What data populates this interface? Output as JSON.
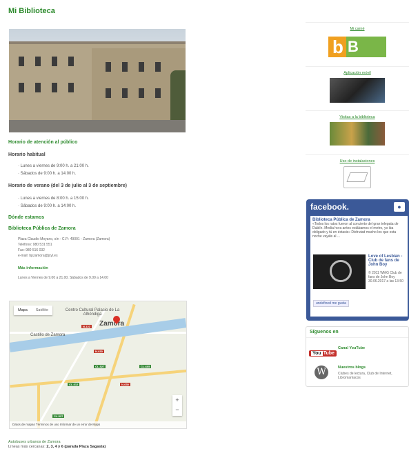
{
  "page": {
    "title": "Mi Biblioteca"
  },
  "hours": {
    "heading": "Horario de atención al público",
    "regular_title": "Horario habitual",
    "regular": [
      "· Lunes a viernes de 9:00 h. a 21:00 h.",
      "· Sábados de 9:00 h. a 14:00 h."
    ],
    "summer_title": "Horario de verano (del 3 de julio al 3 de septiembre)",
    "summer": [
      "· Lunes a viernes de 8:00 h. a 15:00 h.",
      "· Sábados de 9:00 h. a 14:00 h."
    ]
  },
  "location": {
    "heading": "Dónde estamos",
    "library_name": "Biblioteca Pública de Zamora",
    "address": "Plaza Claudio Moyano, s/n - C.P.: 49001 - Zamora (Zamora)",
    "phone": "Teléfono: 980 531 551",
    "fax": "Fax: 980 516 032",
    "email": "e-mail: bpzamora@jcyl.es",
    "more_info_label": "Más información",
    "more_info_text": "Lunes a Viernes de 9.00 a 21.00. Sábados de 9.00 a 14.00"
  },
  "map": {
    "tab_map": "Mapa",
    "tab_sat": "Satélite",
    "label_museum": "Centro Cultural Palacio de La Alhóndiga",
    "label_castle": "Castillo de Zamora",
    "city": "Zamora",
    "zoom_in": "+",
    "zoom_out": "−",
    "footer": "Datos de mapas  Términos de uso   Informar de un error de Maps",
    "roads": [
      "N-122",
      "N-630",
      "CL-527",
      "CL-605",
      "CL-612",
      "N-630",
      "CL-527"
    ]
  },
  "transport": {
    "line1": "Autobuses urbanos de Zamora",
    "line2_label": "Líneas más cercanas:",
    "line2_value": "2, 3, 4 y 6 (parada Plaza Sagasta)"
  },
  "sidebar": {
    "carnet": "Mi carné",
    "app": "Aplicación móvil",
    "visits": "Visitas a la biblioteca",
    "facilities": "Uso de instalaciones"
  },
  "facebook": {
    "brand": "facebook.",
    "page_name": "Biblioteca Pública de Zamora",
    "post_text": "«Todos los ratos fueron al concierto del gran telepata de Dublín. Media hora antes estábamos el metro, yo iba obligado y tú en éxtasis» Disfrutad mucho los que esta noche vayáis al ...",
    "song_title": "Love of Lesbian - Club de fans de John Boy",
    "song_meta": "© 2011 WMG Club de fans de John Boy",
    "date": "30.06.2017 a las 13:50",
    "like_label": "undefined me gusta"
  },
  "follow": {
    "title": "Síguenos en",
    "youtube_label": "Canal YouTube",
    "blogs_label": "Nuestros blogs",
    "blogs_desc": "Clubes de lectura, Club de Internet, Libromaníacos",
    "youtube_logo": "You",
    "youtube_logo_b": "Tube"
  },
  "colors": {
    "accent": "#2e8b2e",
    "facebook": "#3b5998",
    "youtube": "#c4302b"
  }
}
